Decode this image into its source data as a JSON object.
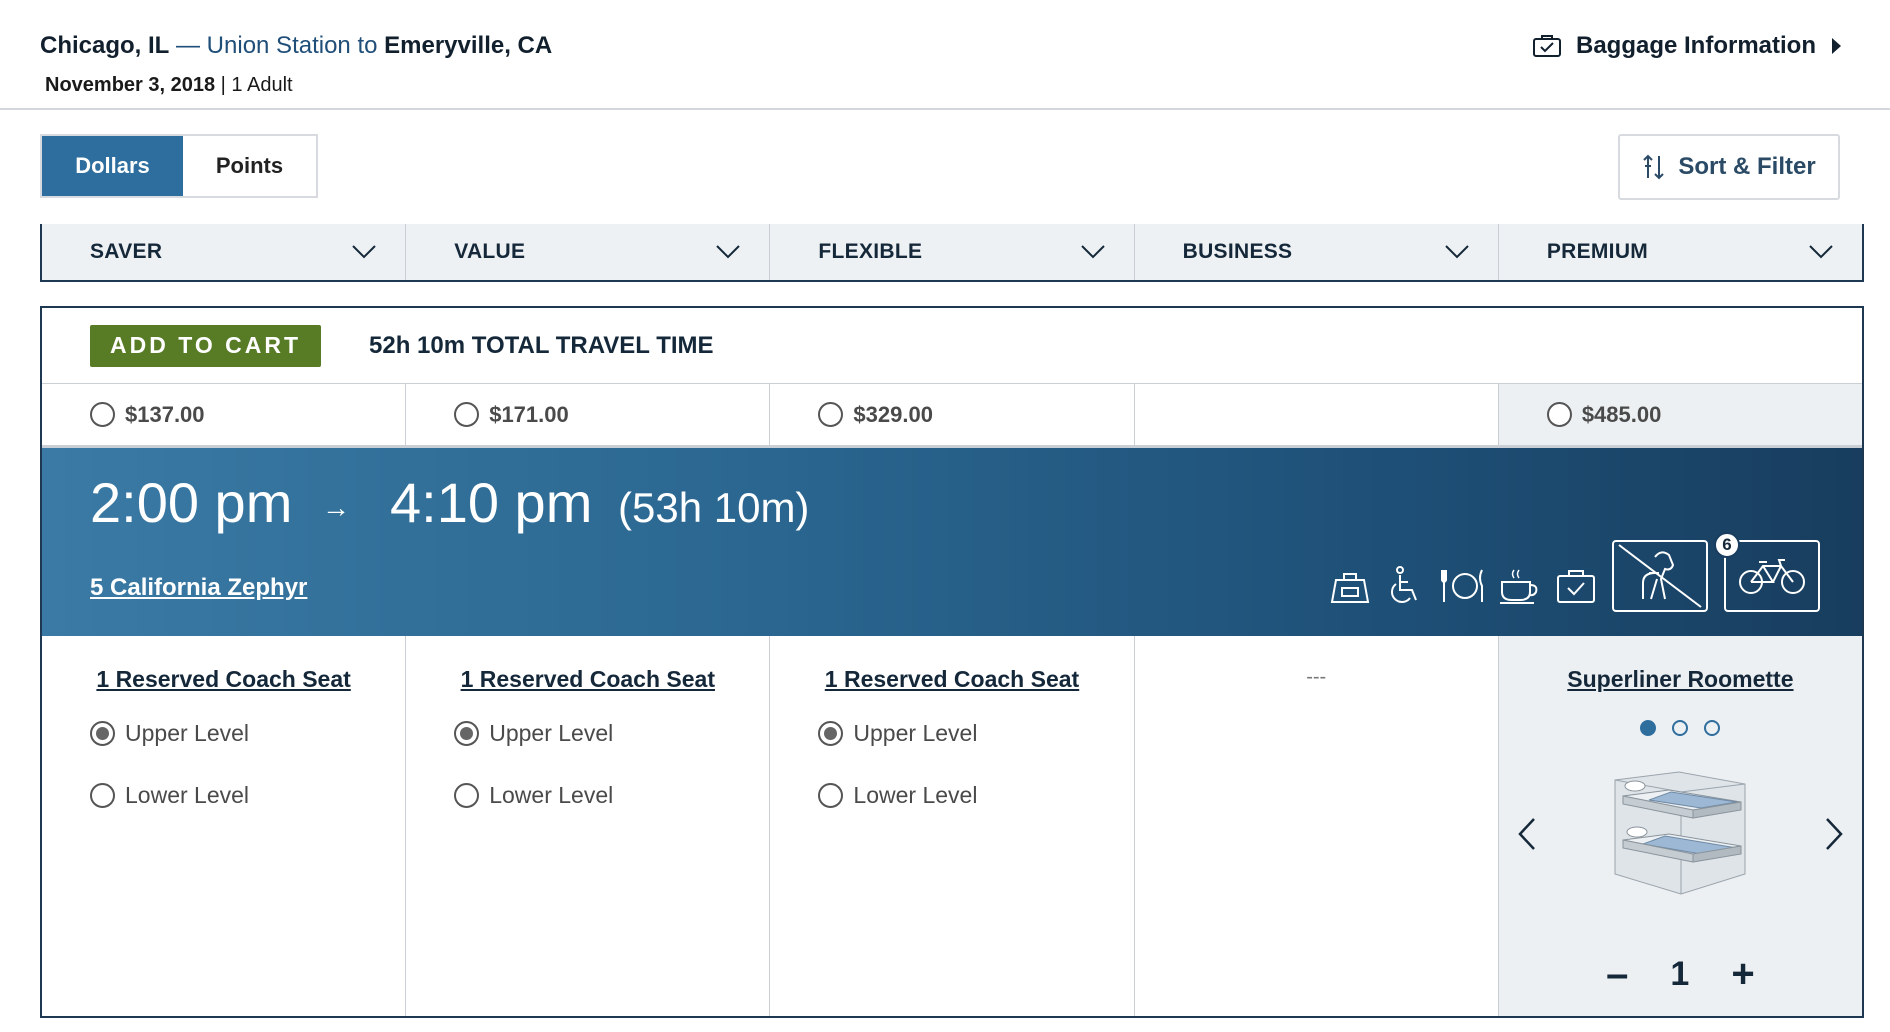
{
  "header": {
    "origin": "Chicago, IL",
    "connector": " — Union Station to ",
    "destination": "Emeryville, CA",
    "date": "November 3, 2018",
    "separator": " | ",
    "travelers": "1 Adult",
    "baggage_label": "Baggage Information"
  },
  "toggle": {
    "dollars": "Dollars",
    "points": "Points",
    "active": "Dollars"
  },
  "sort_filter_label": "Sort & Filter",
  "fare_columns": [
    "SAVER",
    "VALUE",
    "FLEXIBLE",
    "BUSINESS",
    "PREMIUM"
  ],
  "card": {
    "add_to_cart": "ADD TO CART",
    "total_travel_time": "52h 10m TOTAL TRAVEL TIME",
    "prices": [
      "$137.00",
      "$171.00",
      "$329.00",
      "",
      "$485.00"
    ],
    "depart_time": "2:00 pm",
    "arrow": "→",
    "arrive_time": "4:10 pm",
    "duration": "(53h 10m)",
    "train_name": "5 California Zephyr",
    "amenities": [
      "checked-bag-icon",
      "wheelchair-icon",
      "dining-icon",
      "cafe-icon",
      "baggage-icon",
      "no-pets-icon",
      "bicycle-icon"
    ],
    "bike_count": "6",
    "accommodations": [
      {
        "title": "1 Reserved Coach Seat",
        "upper": "Upper Level",
        "lower": "Lower Level",
        "selected": "upper"
      },
      {
        "title": "1 Reserved Coach Seat",
        "upper": "Upper Level",
        "lower": "Lower Level",
        "selected": "upper"
      },
      {
        "title": "1 Reserved Coach Seat",
        "upper": "Upper Level",
        "lower": "Lower Level",
        "selected": "upper"
      },
      {
        "title": "---"
      },
      {
        "title": "Superliner Roomette",
        "carousel_index": 1,
        "carousel_count": 3,
        "minus": "–",
        "quantity": "1",
        "plus": "+"
      }
    ]
  },
  "colors": {
    "primary": "#2e6e9e",
    "navy": "#1d3850",
    "cart_green": "#587b26"
  }
}
